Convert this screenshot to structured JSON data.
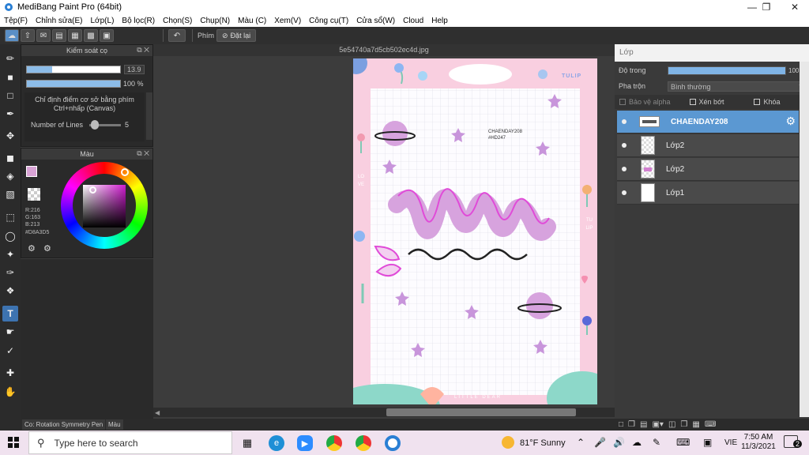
{
  "window": {
    "title": "MediBang Paint Pro (64bit)"
  },
  "menu": [
    "Tệp(F)",
    "Chỉnh sửa(E)",
    "Lớp(L)",
    "Bộ lọc(R)",
    "Chọn(S)",
    "Chụp(N)",
    "Màu (C)",
    "Xem(V)",
    "Công cụ(T)",
    "Cửa sổ(W)",
    "Cloud",
    "Help"
  ],
  "toolbar": {
    "snap_label": "Phím",
    "reset_label": "Đặt lại"
  },
  "brush_panel": {
    "title": "Kiểm soát cọ",
    "size_value": "13.9",
    "size_fraction": 0.27,
    "opacity_value": "100 %",
    "opacity_fraction": 1.0,
    "hint_text": "Chỉ định điểm cơ sở bằng phím Ctrl+nhấp (Canvas)",
    "lines_label": "Number of Lines",
    "lines_value": "5"
  },
  "color_panel": {
    "title": "Màu",
    "r": "R:216",
    "g": "G:163",
    "b": "B:213",
    "hex": "#D8A3D5",
    "color": "#D8A3D5"
  },
  "canvas": {
    "tab": "5e54740a7d5cb502ec4d.jpg",
    "art": {
      "tag_top": "TULIP",
      "note_line1": "CHAENDAY208",
      "note_line2": "#HD247",
      "side_left": "LOVE",
      "side_right": "TULIP",
      "bottom": "LITTLE DEAR"
    }
  },
  "layer_panel": {
    "title": "Lớp",
    "opacity_label": "Độ trong",
    "opacity_value": "100 %",
    "blend_label": "Pha trộn",
    "blend_value": "Bình thường",
    "protect_alpha": "Bảo vệ alpha",
    "clipping": "Xén bớt",
    "lock": "Khóa",
    "layers": [
      "CHAENDAY208",
      "Lớp2",
      "Lớp2",
      "Lớp1"
    ]
  },
  "status": {
    "tool_tab": "Co: Rotation Symmetry Pen",
    "color_tab": "Màu"
  },
  "taskbar": {
    "search_placeholder": "Type here to search",
    "weather": "81°F  Sunny",
    "lang": "VIE",
    "time": "7:50 AM",
    "date": "11/3/2021",
    "notifications": "2"
  }
}
